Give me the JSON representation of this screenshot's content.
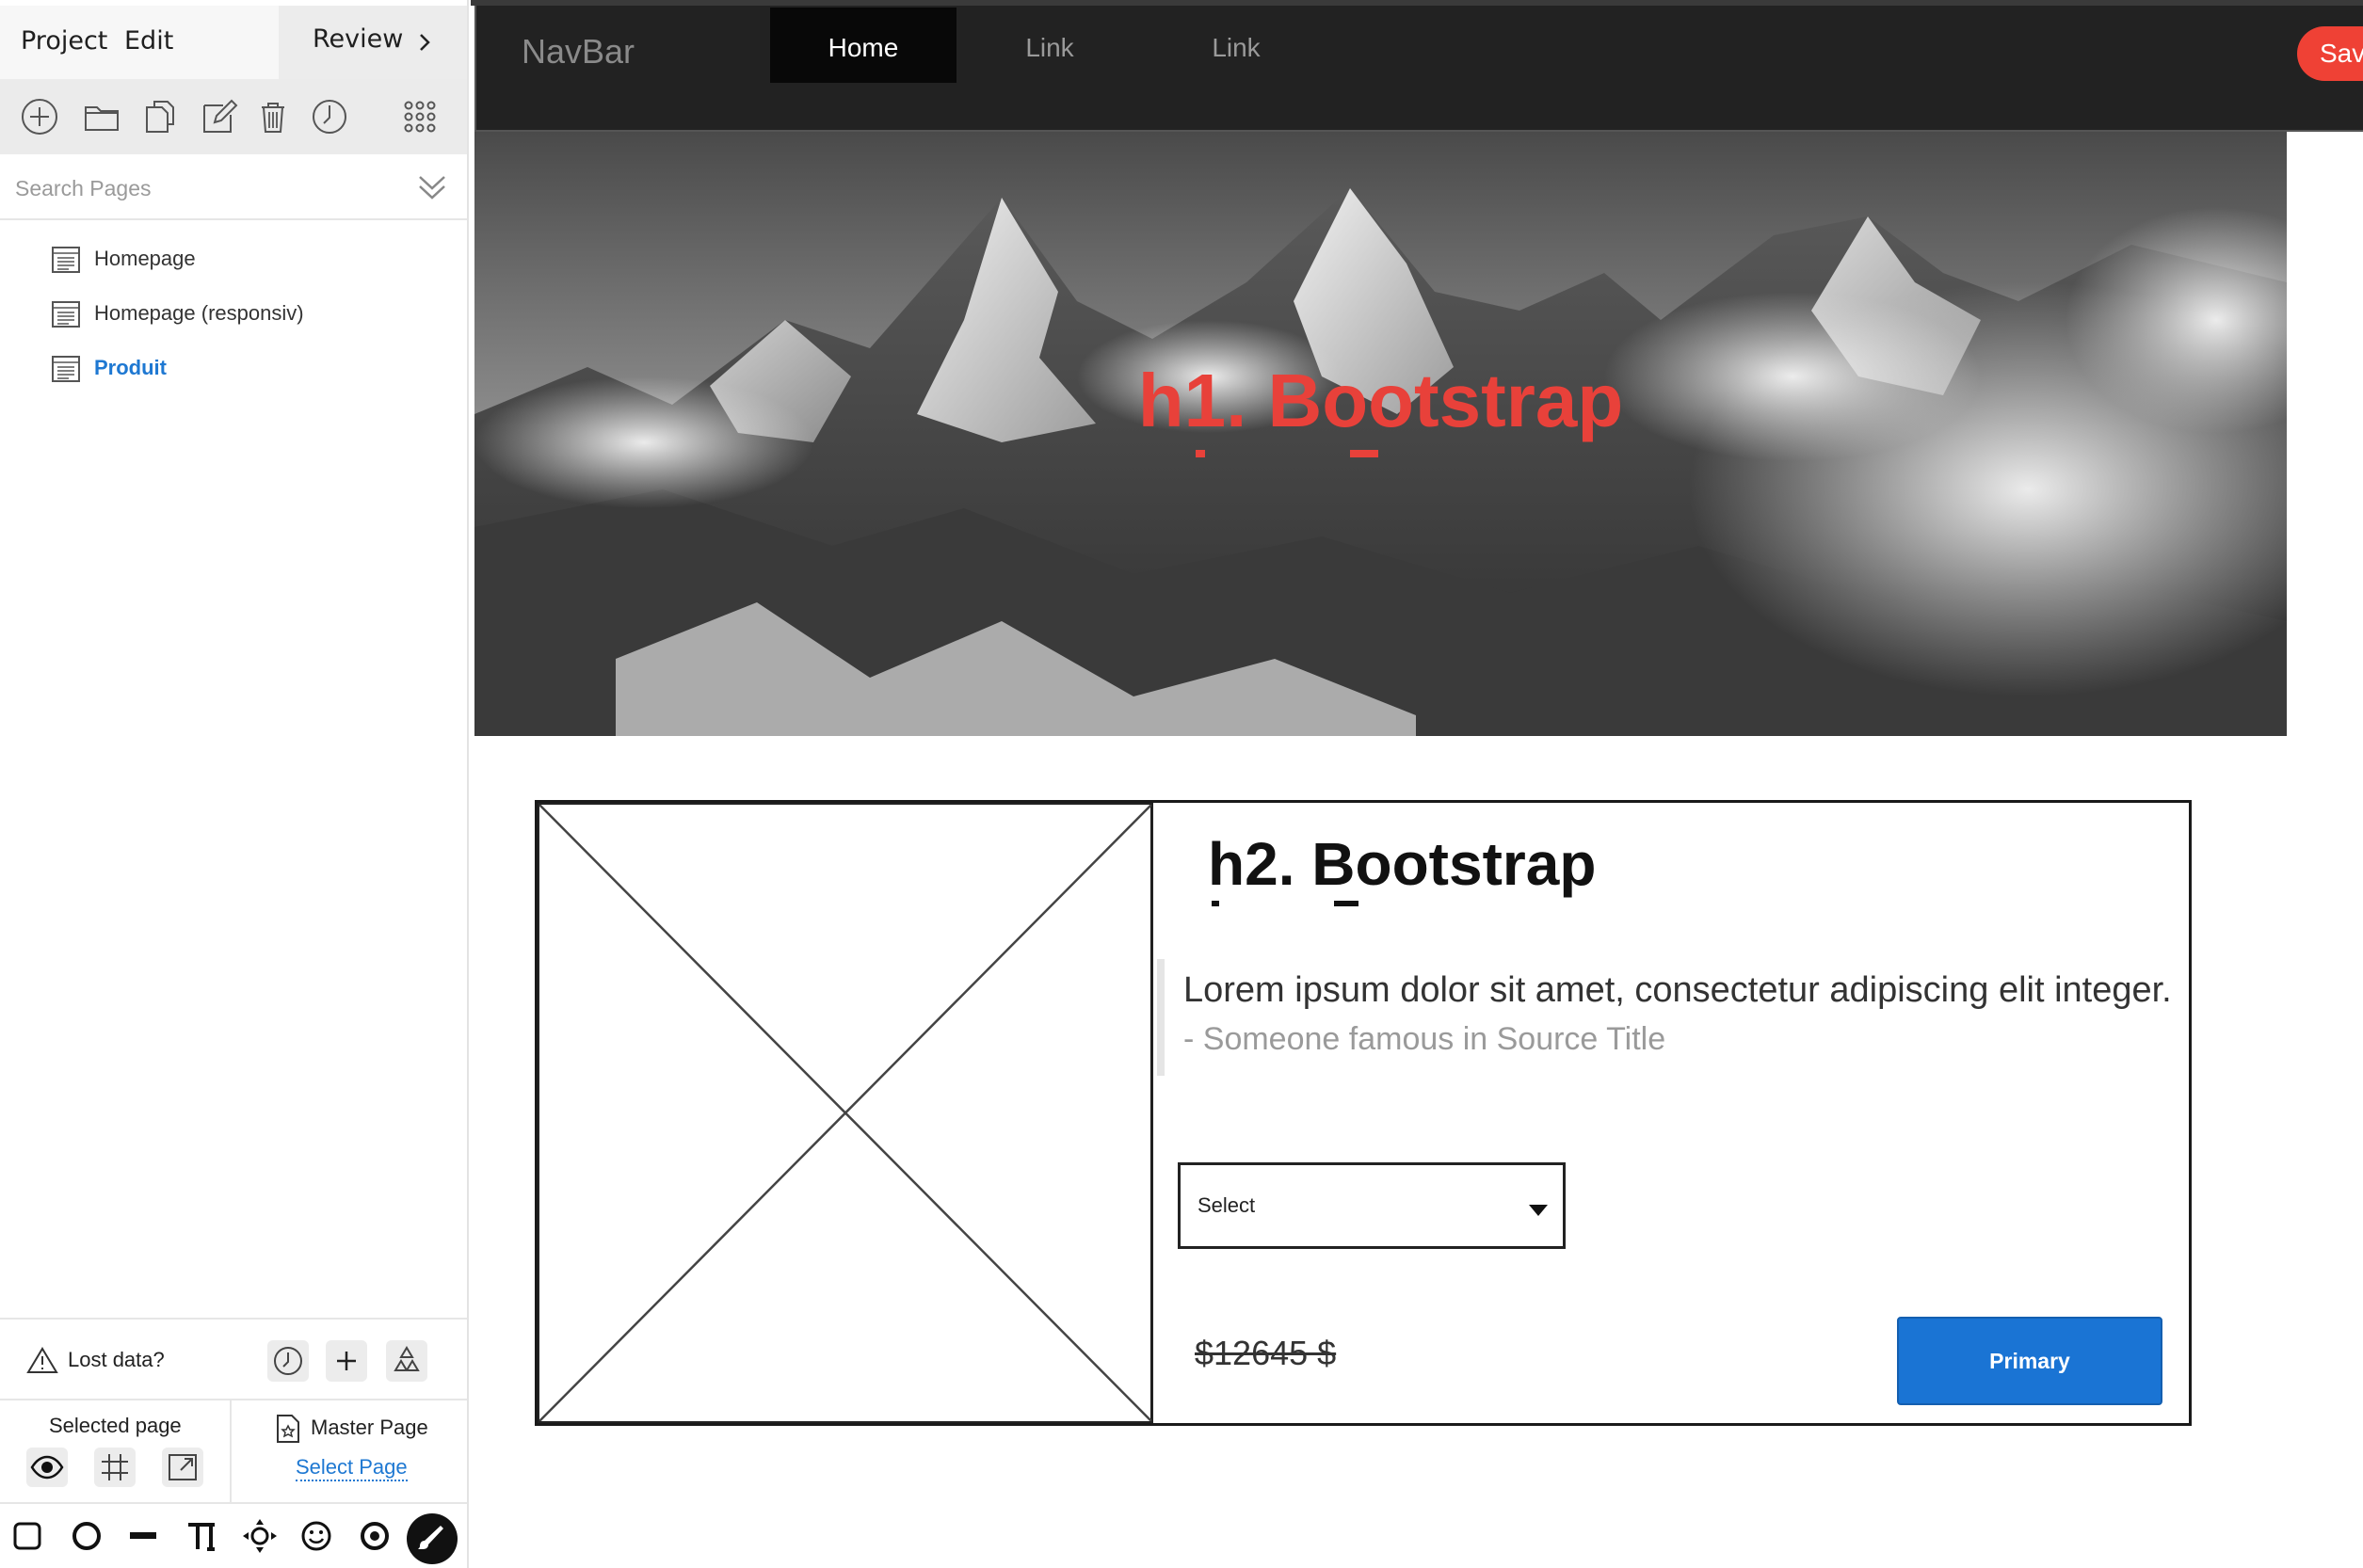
{
  "app": {
    "menu": {
      "project": "Project",
      "edit": "Edit",
      "review": "Review"
    },
    "toolbar": [
      "add-icon",
      "folder-icon",
      "copy-icon",
      "edit-icon",
      "trash-icon",
      "history-icon",
      "apps-grid-icon"
    ],
    "search": {
      "placeholder": "Search Pages"
    },
    "pages": [
      {
        "label": "Homepage",
        "active": false
      },
      {
        "label": "Homepage (responsiv)",
        "active": false
      },
      {
        "label": "Produit",
        "active": true
      }
    ],
    "lost_data": {
      "label": "Lost data?"
    },
    "selected_page": {
      "label": "Selected page"
    },
    "master_page": {
      "label": "Master Page",
      "link": "Select Page"
    }
  },
  "mockup": {
    "navbar": {
      "brand": "NavBar",
      "links": [
        "Home",
        "Link",
        "Link"
      ],
      "active_link": "Home",
      "save": "Save"
    },
    "hero": {
      "title": "h1. Bootstrap"
    },
    "card": {
      "title": "h2. Bootstrap",
      "quote": "Lorem ipsum dolor sit amet, consectetur adipiscing elit integer.",
      "source": "- Someone famous in Source Title",
      "select_value": "Select",
      "price": "$12645 $",
      "button": "Primary"
    }
  },
  "colors": {
    "accent_blue": "#1e78d2",
    "primary_button": "#1a74d4",
    "save_red": "#ef4135",
    "hero_title_red": "#e8413a",
    "navbar_bg": "#222222"
  }
}
